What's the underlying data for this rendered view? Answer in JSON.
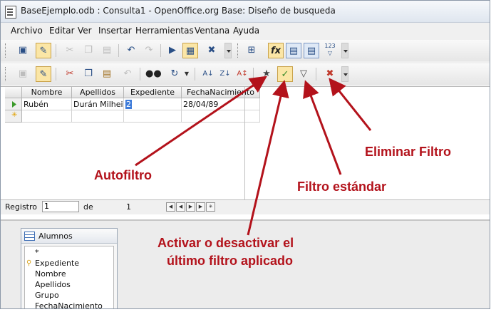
{
  "window": {
    "title": "BaseEjemplo.odb : Consulta1 - OpenOffice.org Base: Diseño de busqueda"
  },
  "menu": [
    "Archivo",
    "Editar",
    "Ver",
    "Insertar",
    "Herramientas",
    "Ventana",
    "Ayuda"
  ],
  "toolbar1": {
    "design_label": "123"
  },
  "grid": {
    "columns": [
      "Nombre",
      "Apellidos",
      "Expediente",
      "FechaNacimiento"
    ],
    "rows": [
      {
        "nombre": "Rubén",
        "apellidos": "Durán Milhei",
        "expediente": "2",
        "fecha": "28/04/89"
      }
    ]
  },
  "record_bar": {
    "label": "Registro",
    "current": "1",
    "of_label": "de",
    "total": "1"
  },
  "table_window": {
    "name": "Alumnos",
    "fields": [
      "*",
      "Expediente",
      "Nombre",
      "Apellidos",
      "Grupo",
      "FechaNacimiento"
    ]
  },
  "annotations": {
    "autofiltro": "Autofiltro",
    "filtro_estandar": "Filtro estándar",
    "eliminar_filtro": "Eliminar Filtro",
    "activar_line1": "Activar o desactivar el",
    "activar_line2": "último filtro aplicado"
  },
  "colors": {
    "annotation": "#b3121b",
    "highlight_button": "#fbe6a6"
  }
}
